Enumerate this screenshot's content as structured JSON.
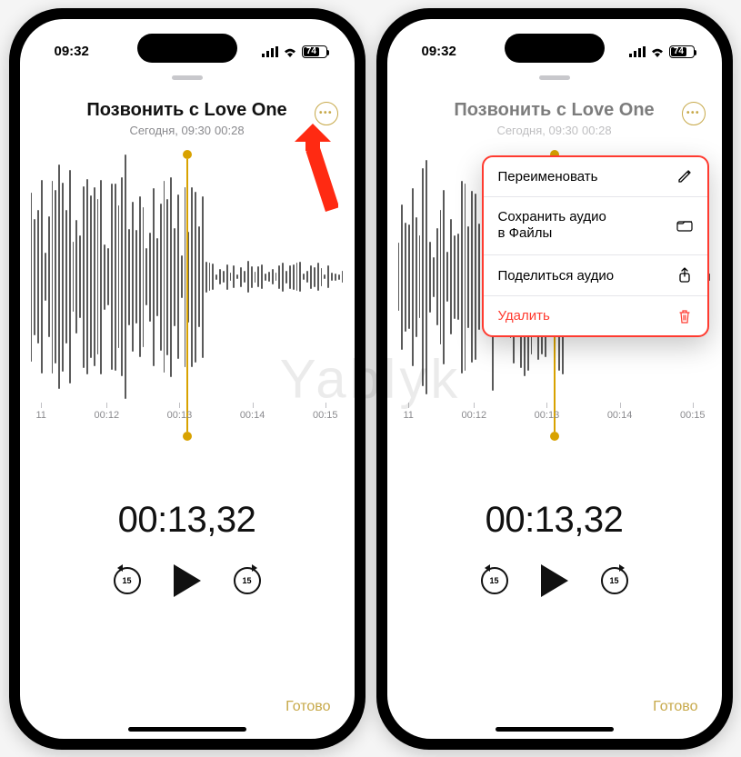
{
  "watermark": "Yablyk",
  "status": {
    "time": "09:32",
    "battery": "74"
  },
  "recording": {
    "title": "Позвонить с Love One",
    "date_prefix": "Сегодня, 09:30",
    "duration": "00:28"
  },
  "ticks": [
    "11",
    "00:12",
    "00:13",
    "00:14",
    "00:15"
  ],
  "playback": {
    "position": "00:13,32",
    "skip_seconds": "15"
  },
  "done_label": "Готово",
  "menu": {
    "rename": "Переименовать",
    "save_line1": "Сохранить аудио",
    "save_line2": "в Файлы",
    "share": "Поделиться аудио",
    "delete": "Удалить"
  },
  "colors": {
    "accent": "#c7a94a",
    "destructive": "#ff3b30",
    "highlight_border": "#ff3b30"
  }
}
